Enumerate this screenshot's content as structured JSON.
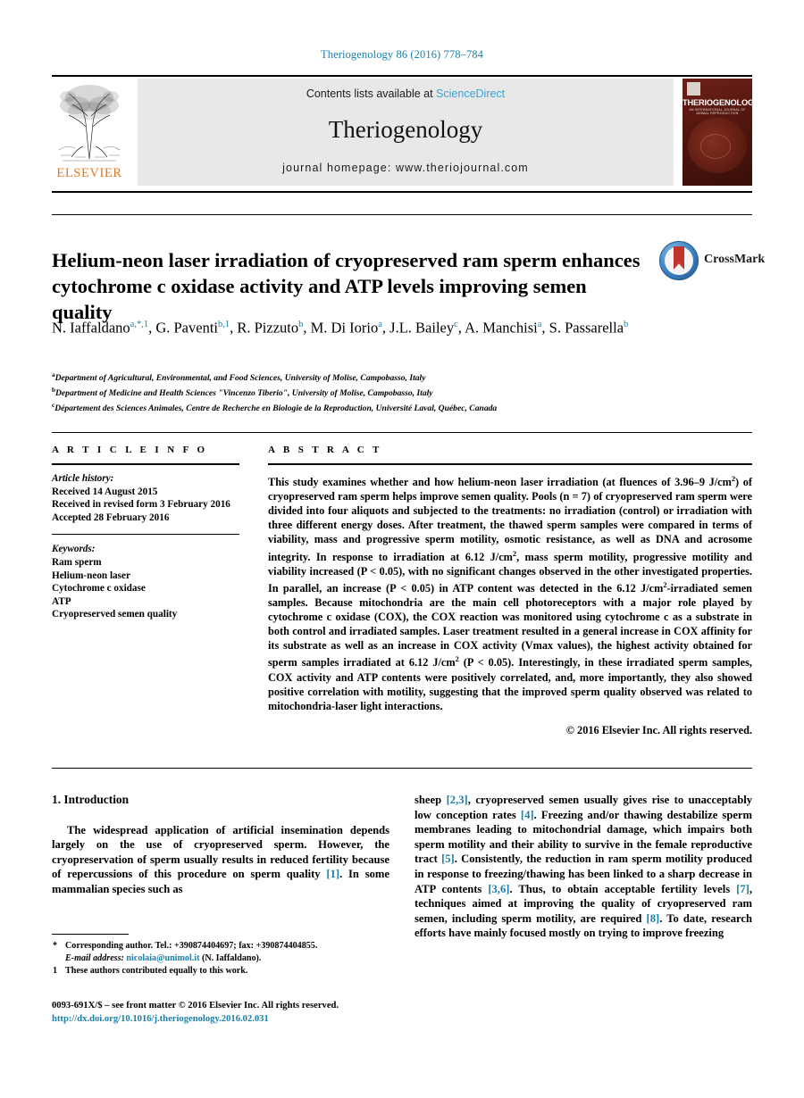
{
  "running_head": "Theriogenology 86 (2016) 778–784",
  "masthead": {
    "contents_prefix": "Contents lists available at ",
    "sciencedirect": "ScienceDirect",
    "journal_name": "Theriogenology",
    "homepage": "journal homepage: www.theriojournal.com",
    "publisher": "ELSEVIER",
    "cover_title": "THERIOGENOLOGY",
    "cover_subtitle": "AN INTERNATIONAL JOURNAL OF ANIMAL REPRODUCTION",
    "accent_link_color": "#3aa3d8"
  },
  "title": "Helium-neon laser irradiation of cryopreserved ram sperm enhances cytochrome c oxidase activity and ATP levels improving semen quality",
  "crossmark_label": "CrossMark",
  "authors": [
    {
      "name": "N. Iaffaldano",
      "sup": "a,*,1",
      "sep": ", "
    },
    {
      "name": "G. Paventi",
      "sup": "b,1",
      "sep": ", "
    },
    {
      "name": "R. Pizzuto",
      "sup": "b",
      "sep": ", "
    },
    {
      "name": "M. Di Iorio",
      "sup": "a",
      "sep": ", "
    },
    {
      "name": "J.L. Bailey",
      "sup": "c",
      "sep": ", "
    },
    {
      "name": "A. Manchisi",
      "sup": "a",
      "sep": ", "
    },
    {
      "name": "S. Passarella",
      "sup": "b",
      "sep": ""
    }
  ],
  "affiliations": [
    {
      "mark": "a",
      "text": "Department of Agricultural, Environmental, and Food Sciences, University of Molise, Campobasso, Italy"
    },
    {
      "mark": "b",
      "text": "Department of Medicine and Health Sciences \"Vincenzo Tiberio\", University of Molise, Campobasso, Italy"
    },
    {
      "mark": "c",
      "text": "Département des Sciences Animales, Centre de Recherche en Biologie de la Reproduction, Université Laval, Québec, Canada"
    }
  ],
  "article_info": {
    "heading": "A R T I C L E   I N F O",
    "history_label": "Article history:",
    "history": [
      "Received 14 August 2015",
      "Received in revised form 3 February 2016",
      "Accepted 28 February 2016"
    ],
    "keywords_label": "Keywords:",
    "keywords": [
      "Ram sperm",
      "Helium-neon laser",
      "Cytochrome c oxidase",
      "ATP",
      "Cryopreserved semen quality"
    ]
  },
  "abstract": {
    "heading": "A B S T R A C T",
    "paragraph_part1": "This study examines whether and how helium-neon laser irradiation (at fluences of 3.96–9 J/cm",
    "sup1": "2",
    "paragraph_part2": ") of cryopreserved ram sperm helps improve semen quality. Pools (n = 7) of cryopreserved ram sperm were divided into four aliquots and subjected to the treatments: no irradiation (control) or irradiation with three different energy doses. After treatment, the thawed sperm samples were compared in terms of viability, mass and progressive sperm motility, osmotic resistance, as well as DNA and acrosome integrity. In response to irradiation at 6.12 J/cm",
    "sup2": "2",
    "paragraph_part3": ", mass sperm motility, progressive motility and viability increased (P < 0.05), with no significant changes observed in the other investigated properties. In parallel, an increase (P < 0.05) in ATP content was detected in the 6.12 J/cm",
    "sup3": "2",
    "paragraph_part4": "-irradiated semen samples. Because mitochondria are the main cell photoreceptors with a major role played by cytochrome c oxidase (COX), the COX reaction was monitored using cytochrome c as a substrate in both control and irradiated samples. Laser treatment resulted in a general increase in COX affinity for its substrate as well as an increase in COX activity (Vmax values), the highest activity obtained for sperm samples irradiated at 6.12 J/cm",
    "sup4": "2",
    "paragraph_part5": " (P < 0.05). Interestingly, in these irradiated sperm samples, COX activity and ATP contents were positively correlated, and, more importantly, they also showed positive correlation with motility, suggesting that the improved sperm quality observed was related to mitochondria-laser light interactions.",
    "copyright": "© 2016 Elsevier Inc. All rights reserved."
  },
  "introduction": {
    "section_title": "1. Introduction",
    "left_part1": "The widespread application of artificial insemination depends largely on the use of cryopreserved sperm. However, the cryopreservation of sperm usually results in reduced fertility because of repercussions of this procedure on sperm quality ",
    "cit_left1": "[1]",
    "left_part2": ". In some mammalian species such as",
    "right_part1": "sheep ",
    "cit_r1": "[2,3]",
    "right_part2": ", cryopreserved semen usually gives rise to unacceptably low conception rates ",
    "cit_r2": "[4]",
    "right_part3": ". Freezing and/or thawing destabilize sperm membranes leading to mitochondrial damage, which impairs both sperm motility and their ability to survive in the female reproductive tract ",
    "cit_r3": "[5]",
    "right_part4": ". Consistently, the reduction in ram sperm motility produced in response to freezing/thawing has been linked to a sharp decrease in ATP contents ",
    "cit_r4": "[3,6]",
    "right_part5": ". Thus, to obtain acceptable fertility levels ",
    "cit_r5": "[7]",
    "right_part6": ", techniques aimed at improving the quality of cryopreserved ram semen, including sperm motility, are required ",
    "cit_r6": "[8]",
    "right_part7": ". To date, research efforts have mainly focused mostly on trying to improve freezing"
  },
  "footnotes": {
    "corresponding_mark": "*",
    "corresponding_text": "Corresponding author. Tel.: +390874404697; fax: +390874404855.",
    "email_label": "E-mail address:",
    "email": "nicolaia@unimol.it",
    "email_owner": "(N. Iaffaldano).",
    "equal_mark": "1",
    "equal_text": "These authors contributed equally to this work."
  },
  "imprint": {
    "issn_line": "0093-691X/$ – see front matter © 2016 Elsevier Inc. All rights reserved.",
    "doi": "http://dx.doi.org/10.1016/j.theriogenology.2016.02.031"
  }
}
